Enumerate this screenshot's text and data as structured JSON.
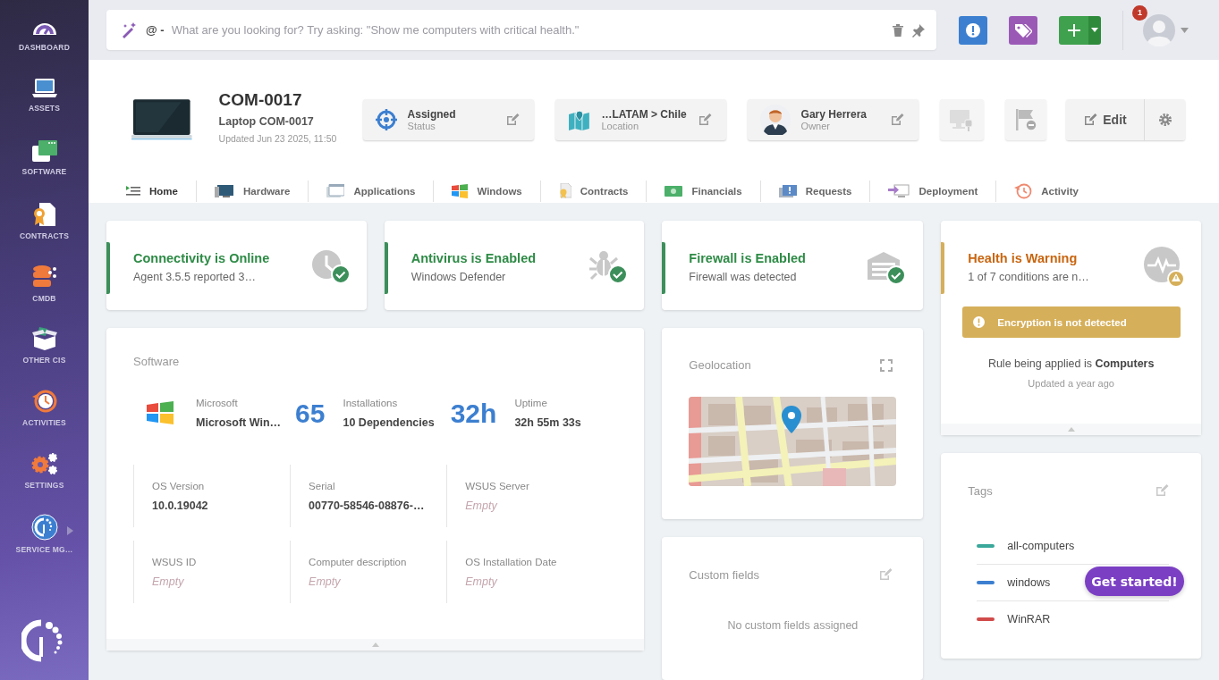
{
  "sidebar": {
    "items": [
      {
        "label": "DASHBOARD",
        "submenu": false
      },
      {
        "label": "ASSETS",
        "submenu": false
      },
      {
        "label": "SOFTWARE",
        "submenu": false
      },
      {
        "label": "CONTRACTS",
        "submenu": false
      },
      {
        "label": "CMDB",
        "submenu": false
      },
      {
        "label": "OTHER CIS",
        "submenu": false
      },
      {
        "label": "ACTIVITIES",
        "submenu": false
      },
      {
        "label": "SETTINGS",
        "submenu": false
      },
      {
        "label": "SERVICE MG…",
        "submenu": true
      }
    ]
  },
  "search": {
    "prefix": "@ -",
    "placeholder": "What are you looking for? Try asking: \"Show me computers with critical health.\""
  },
  "notifications": {
    "count": "1"
  },
  "asset": {
    "name": "COM-0017",
    "subtitle": "Laptop COM-0017",
    "updated": "Updated Jun 23 2025, 11:50"
  },
  "header_fields": [
    {
      "value": "Assigned",
      "label": "Status"
    },
    {
      "value": "…LATAM > Chile",
      "label": "Location"
    },
    {
      "value": "Gary Herrera",
      "label": "Owner"
    }
  ],
  "edit_button": "Edit",
  "tabs": [
    {
      "label": "Home",
      "selected": true
    },
    {
      "label": "Hardware",
      "selected": false
    },
    {
      "label": "Applications",
      "selected": false
    },
    {
      "label": "Windows",
      "selected": false
    },
    {
      "label": "Contracts",
      "selected": false
    },
    {
      "label": "Financials",
      "selected": false
    },
    {
      "label": "Requests",
      "selected": false
    },
    {
      "label": "Deployment",
      "selected": false
    },
    {
      "label": "Activity",
      "selected": false
    }
  ],
  "status_cards": [
    {
      "kind": "ok",
      "title": "Connectivity is Online",
      "detail": "Agent 3.5.5 reported 3…"
    },
    {
      "kind": "ok",
      "title": "Antivirus is Enabled",
      "detail": "Windows Defender"
    },
    {
      "kind": "ok",
      "title": "Firewall is Enabled",
      "detail": "Firewall was detected"
    },
    {
      "kind": "warning",
      "title": "Health is Warning",
      "detail": "1 of 7 conditions are n…",
      "alert": "Encryption is not detected",
      "rule": "Rule being applied is **Computers**",
      "updated": "Updated a year ago"
    }
  ],
  "software": {
    "title": "Software",
    "stats": [
      {
        "label": "Microsoft",
        "value": "Microsoft Win…"
      },
      {
        "big": "65",
        "label": "Installations",
        "value": "10 Dependencies"
      },
      {
        "big": "32h",
        "label": "Uptime",
        "value": "32h 55m 33s"
      }
    ],
    "fields": [
      {
        "label": "OS Version",
        "value": "10.0.19042",
        "empty": false
      },
      {
        "label": "Serial",
        "value": "00770-58546-08876-…",
        "empty": false
      },
      {
        "label": "WSUS Server",
        "value": "Empty",
        "empty": true
      },
      {
        "label": "WSUS ID",
        "value": "Empty",
        "empty": true
      },
      {
        "label": "Computer description",
        "value": "Empty",
        "empty": true
      },
      {
        "label": "OS Installation Date",
        "value": "Empty",
        "empty": true
      }
    ]
  },
  "geolocation": {
    "title": "Geolocation"
  },
  "custom_fields": {
    "title": "Custom fields",
    "message": "No custom fields assigned"
  },
  "tags": {
    "title": "Tags",
    "items": [
      {
        "label": "all-computers",
        "color": "#3aa79a"
      },
      {
        "label": "windows",
        "color": "#3c7fd0"
      },
      {
        "label": "WinRAR",
        "color": "#d14b4b"
      }
    ]
  },
  "get_started": "Get started!"
}
